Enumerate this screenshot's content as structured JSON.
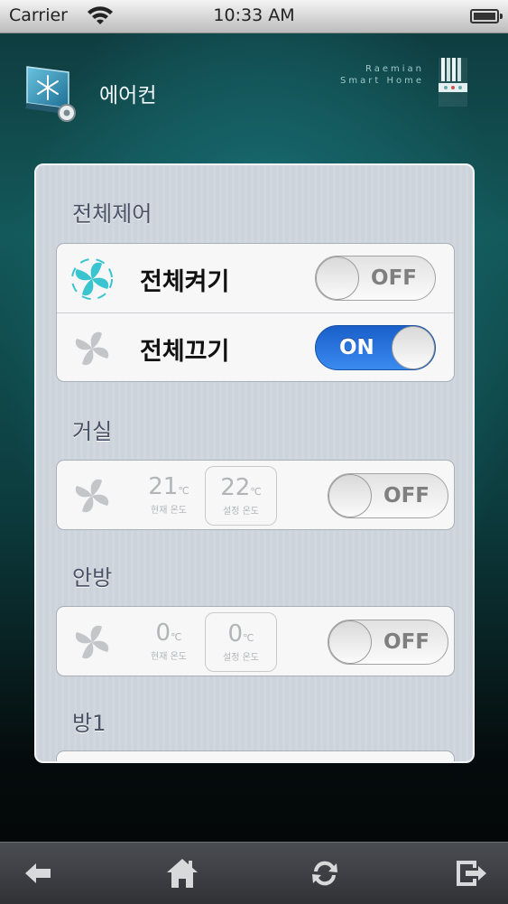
{
  "status_bar": {
    "carrier": "Carrier",
    "time": "10:33 AM"
  },
  "header": {
    "title": "에어컨",
    "brand_line1": "Raemian",
    "brand_line2": "Smart Home",
    "app_icon": "aircon-snowflake-gear-icon",
    "brand_logo": "raemian-logo"
  },
  "sections": {
    "all_control": {
      "title": "전체제어",
      "rows": [
        {
          "label": "전체켜기",
          "toggle": "OFF",
          "icon": "fan-active-icon"
        },
        {
          "label": "전체끄기",
          "toggle": "ON",
          "icon": "fan-inactive-icon"
        }
      ]
    },
    "living_room": {
      "title": "거실",
      "current_temp": "21",
      "current_unit": "℃",
      "current_caption": "현재 온도",
      "set_temp": "22",
      "set_unit": "℃",
      "set_caption": "설정 온도",
      "toggle": "OFF"
    },
    "master_room": {
      "title": "안방",
      "current_temp": "0",
      "current_unit": "℃",
      "current_caption": "현재 온도",
      "set_temp": "0",
      "set_unit": "℃",
      "set_caption": "설정 온도",
      "toggle": "OFF"
    },
    "room1": {
      "title": "방1"
    }
  },
  "bottom_bar": {
    "icons": [
      "back-arrow-icon",
      "home-icon",
      "refresh-icon",
      "exit-icon"
    ]
  },
  "colors": {
    "toggle_on": "#2f7de6",
    "panel": "#cdd3db",
    "fan_active": "#3ec8d0"
  }
}
